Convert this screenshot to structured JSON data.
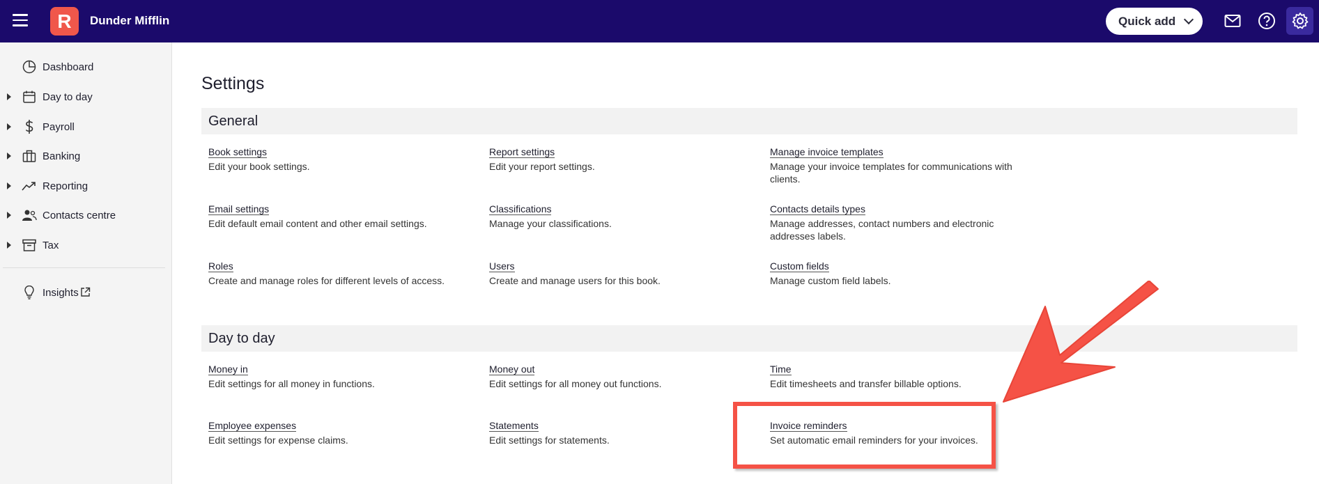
{
  "topbar": {
    "logo_letter": "R",
    "company_name": "Dunder Mifflin",
    "quick_add_label": "Quick add"
  },
  "sidebar": {
    "items": [
      {
        "label": "Dashboard",
        "icon": "pie-chart-icon"
      },
      {
        "label": "Day to day",
        "icon": "calendar-icon"
      },
      {
        "label": "Payroll",
        "icon": "dollar-icon"
      },
      {
        "label": "Banking",
        "icon": "bank-icon"
      },
      {
        "label": "Reporting",
        "icon": "trend-icon"
      },
      {
        "label": "Contacts centre",
        "icon": "people-icon"
      },
      {
        "label": "Tax",
        "icon": "archive-icon"
      },
      {
        "label": "Insights",
        "icon": "lightbulb-icon"
      }
    ]
  },
  "main": {
    "title": "Settings",
    "sections": [
      {
        "heading": "General",
        "items": [
          {
            "link": "Book settings",
            "desc": "Edit your book settings."
          },
          {
            "link": "Report settings",
            "desc": "Edit your report settings."
          },
          {
            "link": "Manage invoice templates",
            "desc": "Manage your invoice templates for communications with clients."
          },
          {
            "link": "Email settings",
            "desc": "Edit default email content and other email settings."
          },
          {
            "link": "Classifications",
            "desc": "Manage your classifications."
          },
          {
            "link": "Contacts details types",
            "desc": "Manage addresses, contact numbers and electronic addresses labels."
          },
          {
            "link": "Roles",
            "desc": "Create and manage roles for different levels of access."
          },
          {
            "link": "Users",
            "desc": "Create and manage users for this book."
          },
          {
            "link": "Custom fields",
            "desc": "Manage custom field labels."
          }
        ]
      },
      {
        "heading": "Day to day",
        "items": [
          {
            "link": "Money in",
            "desc": "Edit settings for all money in functions."
          },
          {
            "link": "Money out",
            "desc": "Edit settings for all money out functions."
          },
          {
            "link": "Time",
            "desc": "Edit timesheets and transfer billable options."
          },
          {
            "link": "Employee expenses",
            "desc": "Edit settings for expense claims."
          },
          {
            "link": "Statements",
            "desc": "Edit settings for statements."
          },
          {
            "link": "Invoice reminders",
            "desc": "Set automatic email reminders for your invoices."
          }
        ]
      }
    ]
  },
  "colors": {
    "topbar": "#1b0a6b",
    "brand": "#f0574b",
    "annotation": "#f55246"
  }
}
